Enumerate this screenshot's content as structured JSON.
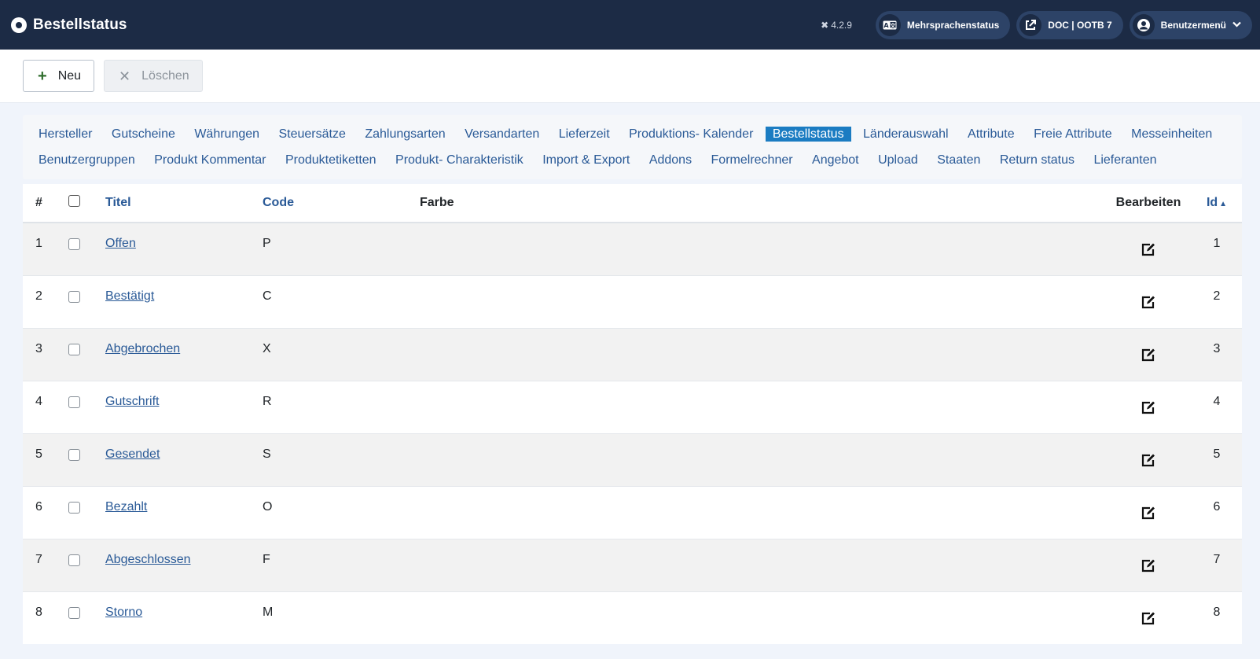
{
  "header": {
    "title": "Bestellstatus",
    "version": "4.2.9",
    "multilang_label": "Mehrsprachenstatus",
    "site_label": "DOC | OOTB 7",
    "user_menu_label": "Benutzermenü"
  },
  "toolbar": {
    "new_label": "Neu",
    "delete_label": "Löschen"
  },
  "nav": {
    "items": [
      {
        "label": "Hersteller",
        "active": false
      },
      {
        "label": "Gutscheine",
        "active": false
      },
      {
        "label": "Währungen",
        "active": false
      },
      {
        "label": "Steuersätze",
        "active": false
      },
      {
        "label": "Zahlungsarten",
        "active": false
      },
      {
        "label": "Versandarten",
        "active": false
      },
      {
        "label": "Lieferzeit",
        "active": false
      },
      {
        "label": "Produktions- Kalender",
        "active": false
      },
      {
        "label": "Bestellstatus",
        "active": true
      },
      {
        "label": "Länderauswahl",
        "active": false
      },
      {
        "label": "Attribute",
        "active": false
      },
      {
        "label": "Freie Attribute",
        "active": false
      },
      {
        "label": "Messeinheiten",
        "active": false
      },
      {
        "label": "Benutzergruppen",
        "active": false
      },
      {
        "label": "Produkt Kommentar",
        "active": false
      },
      {
        "label": "Produktetiketten",
        "active": false
      },
      {
        "label": "Produkt- Charakteristik",
        "active": false
      },
      {
        "label": "Import & Export",
        "active": false
      },
      {
        "label": "Addons",
        "active": false
      },
      {
        "label": "Formelrechner",
        "active": false
      },
      {
        "label": "Angebot",
        "active": false
      },
      {
        "label": "Upload",
        "active": false
      },
      {
        "label": "Staaten",
        "active": false
      },
      {
        "label": "Return status",
        "active": false
      },
      {
        "label": "Lieferanten",
        "active": false
      }
    ]
  },
  "table": {
    "headers": {
      "num": "#",
      "title": "Titel",
      "code": "Code",
      "color": "Farbe",
      "edit": "Bearbeiten",
      "id": "Id"
    },
    "rows": [
      {
        "num": "1",
        "title": "Offen",
        "code": "P",
        "id": "1"
      },
      {
        "num": "2",
        "title": "Bestätigt",
        "code": "C",
        "id": "2"
      },
      {
        "num": "3",
        "title": "Abgebrochen",
        "code": "X",
        "id": "3"
      },
      {
        "num": "4",
        "title": "Gutschrift",
        "code": "R",
        "id": "4"
      },
      {
        "num": "5",
        "title": "Gesendet",
        "code": "S",
        "id": "5"
      },
      {
        "num": "6",
        "title": "Bezahlt",
        "code": "O",
        "id": "6"
      },
      {
        "num": "7",
        "title": "Abgeschlossen",
        "code": "F",
        "id": "7"
      },
      {
        "num": "8",
        "title": "Storno",
        "code": "M",
        "id": "8"
      }
    ]
  },
  "colors": {
    "header_bg": "#1c2b45",
    "pill_bg": "#2d4367",
    "link": "#2a5a97",
    "active_tab": "#1b7cc2"
  }
}
